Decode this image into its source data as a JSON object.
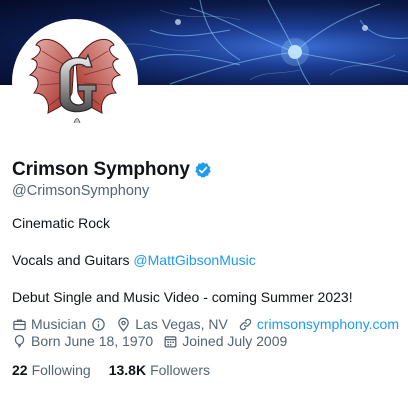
{
  "profile": {
    "name": "Crimson Symphony",
    "handle": "@CrimsonSymphony",
    "verified": true
  },
  "bio": {
    "line1": "Cinematic Rock",
    "line2_text": "Vocals and Guitars ",
    "line2_mention": "@MattGibsonMusic",
    "line3": "Debut Single and Music Video - coming Summer 2023!"
  },
  "meta": {
    "category": "Musician",
    "location": "Las Vegas, NV",
    "website": "crimsonsymphony.com",
    "birthday": "Born June 18, 1970",
    "joined": "Joined July 2009"
  },
  "stats": {
    "following_count": "22",
    "following_label": "Following",
    "followers_count": "13.8K",
    "followers_label": "Followers"
  },
  "colors": {
    "link": "#1d9bf0",
    "secondary_text": "#536471",
    "verified_badge": "#1d9bf0"
  },
  "icons": {
    "category": "briefcase-icon",
    "info": "info-icon",
    "location": "location-pin-icon",
    "website": "link-icon",
    "birthday": "balloon-icon",
    "joined": "calendar-icon",
    "verified": "verified-badge-icon"
  }
}
